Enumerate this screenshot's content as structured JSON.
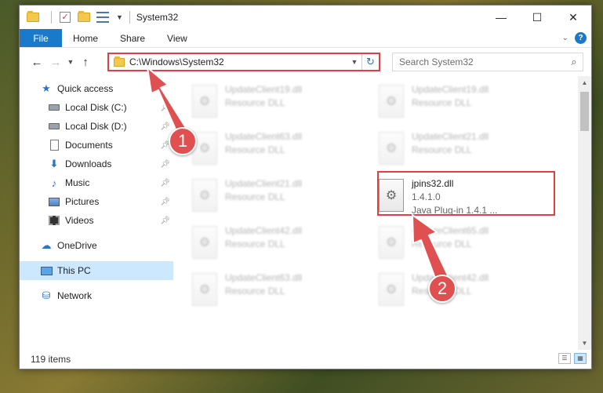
{
  "window": {
    "title": "System32",
    "controls": {
      "minimize": "—",
      "maximize": "☐",
      "close": "✕"
    }
  },
  "ribbon": {
    "file": "File",
    "tabs": [
      "Home",
      "Share",
      "View"
    ],
    "help": "?"
  },
  "address": {
    "path": "C:\\Windows\\System32",
    "refresh": "↻"
  },
  "search": {
    "placeholder": "Search System32"
  },
  "sidebar": {
    "quick_access": "Quick access",
    "items": [
      {
        "label": "Local Disk (C:)",
        "icon": "drive-icon"
      },
      {
        "label": "Local Disk (D:)",
        "icon": "drive-icon"
      },
      {
        "label": "Documents",
        "icon": "documents-icon"
      },
      {
        "label": "Downloads",
        "icon": "download-icon"
      },
      {
        "label": "Music",
        "icon": "music-icon"
      },
      {
        "label": "Pictures",
        "icon": "pictures-icon"
      },
      {
        "label": "Videos",
        "icon": "videos-icon"
      }
    ],
    "onedrive": "OneDrive",
    "this_pc": "This PC",
    "network": "Network"
  },
  "files": [
    {
      "name": "UpdateClient19.dll",
      "desc": "Resource DLL"
    },
    {
      "name": "UpdateClient19.dll",
      "desc": "Resource DLL"
    },
    {
      "name": "UpdateClient63.dll",
      "desc": "Resource DLL"
    },
    {
      "name": "UpdateClient21.dll",
      "desc": "Resource DLL"
    },
    {
      "name": "UpdateClient21.dll",
      "desc": "Resource DLL"
    },
    {
      "name": "UpdateClient42.dll",
      "desc": "Resource DLL"
    },
    {
      "name": "UpdateClient65.dll",
      "desc": "Resource DLL"
    },
    {
      "name": "UpdateClient63.dll",
      "desc": "Resource DLL"
    },
    {
      "name": "UpdateClient42.dll",
      "desc": "Resource DLL"
    }
  ],
  "selected_file": {
    "name": "jpins32.dll",
    "version": "1.4.1.0",
    "desc": "Java Plug-in 1.4.1 ..."
  },
  "status": {
    "count": "119 items"
  },
  "annotations": {
    "step1": "1",
    "step2": "2"
  },
  "colors": {
    "accent": "#1979ca",
    "highlight": "#e04040",
    "selected_nav": "#cce8ff"
  }
}
